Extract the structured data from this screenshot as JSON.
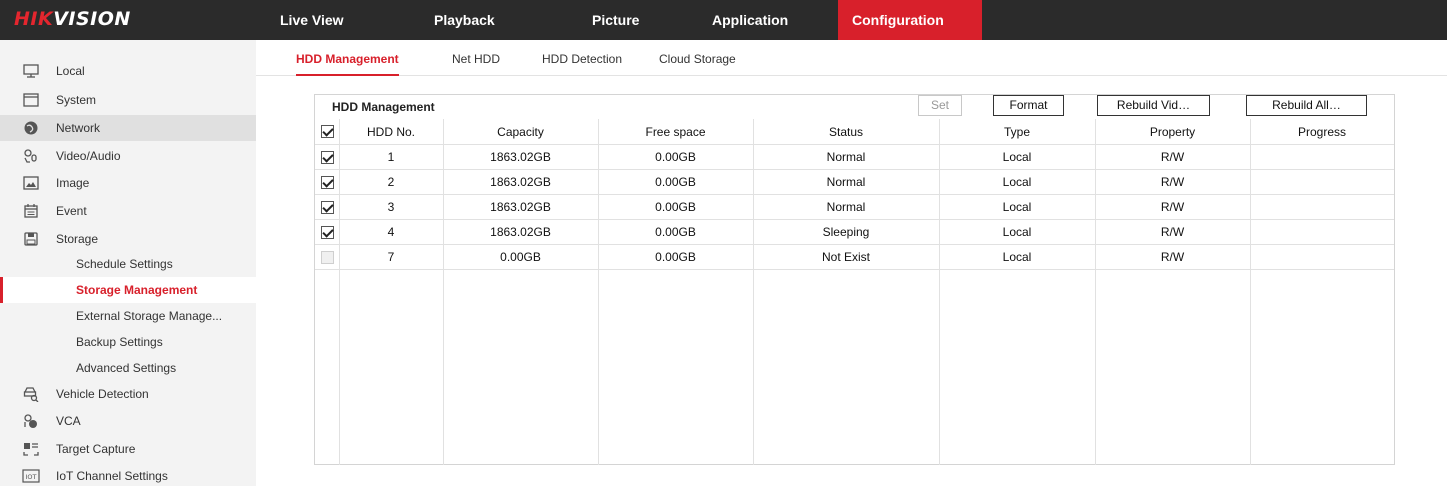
{
  "brand": {
    "part1": "HIK",
    "part2": "VISION"
  },
  "nav": [
    {
      "label": "Live View"
    },
    {
      "label": "Playback"
    },
    {
      "label": "Picture"
    },
    {
      "label": "Application"
    },
    {
      "label": "Configuration",
      "active": true
    }
  ],
  "sidebar": {
    "items": [
      {
        "label": "Local",
        "icon": "monitor-icon"
      },
      {
        "label": "System",
        "icon": "window-icon"
      },
      {
        "label": "Network",
        "icon": "globe-icon"
      },
      {
        "label": "Video/Audio",
        "icon": "camera-mic-icon"
      },
      {
        "label": "Image",
        "icon": "image-icon"
      },
      {
        "label": "Event",
        "icon": "calendar-icon"
      },
      {
        "label": "Storage",
        "icon": "storage-icon"
      }
    ],
    "storage_sub": [
      {
        "label": "Schedule Settings"
      },
      {
        "label": "Storage Management",
        "active": true
      },
      {
        "label": "External Storage Manage..."
      },
      {
        "label": "Backup Settings"
      },
      {
        "label": "Advanced Settings"
      }
    ],
    "items_after": [
      {
        "label": "Vehicle Detection",
        "icon": "vehicle-detection-icon"
      },
      {
        "label": "VCA",
        "icon": "vca-icon"
      },
      {
        "label": "Target Capture",
        "icon": "target-capture-icon"
      },
      {
        "label": "IoT Channel Settings",
        "icon": "iot-icon"
      }
    ]
  },
  "tabs": [
    {
      "label": "HDD Management",
      "active": true
    },
    {
      "label": "Net HDD"
    },
    {
      "label": "HDD Detection"
    },
    {
      "label": "Cloud Storage"
    }
  ],
  "panel": {
    "title": "HDD Management",
    "buttons": {
      "set": "Set",
      "format": "Format",
      "rebuild_vid": "Rebuild Vid…",
      "rebuild_all": "Rebuild All…"
    }
  },
  "table": {
    "columns": [
      "HDD No.",
      "Capacity",
      "Free space",
      "Status",
      "Type",
      "Property",
      "Progress"
    ],
    "rows": [
      {
        "checked": true,
        "no": "1",
        "capacity": "1863.02GB",
        "free": "0.00GB",
        "status": "Normal",
        "type": "Local",
        "property": "R/W",
        "progress": ""
      },
      {
        "checked": true,
        "no": "2",
        "capacity": "1863.02GB",
        "free": "0.00GB",
        "status": "Normal",
        "type": "Local",
        "property": "R/W",
        "progress": ""
      },
      {
        "checked": true,
        "no": "3",
        "capacity": "1863.02GB",
        "free": "0.00GB",
        "status": "Normal",
        "type": "Local",
        "property": "R/W",
        "progress": ""
      },
      {
        "checked": true,
        "no": "4",
        "capacity": "1863.02GB",
        "free": "0.00GB",
        "status": "Sleeping",
        "type": "Local",
        "property": "R/W",
        "progress": ""
      },
      {
        "checked": false,
        "disabled": true,
        "no": "7",
        "capacity": "0.00GB",
        "free": "0.00GB",
        "status": "Not Exist",
        "type": "Local",
        "property": "R/W",
        "progress": ""
      }
    ]
  },
  "colors": {
    "accent": "#d8202b",
    "topbar": "#2b2b2b",
    "sidebar": "#f3f3f3"
  }
}
